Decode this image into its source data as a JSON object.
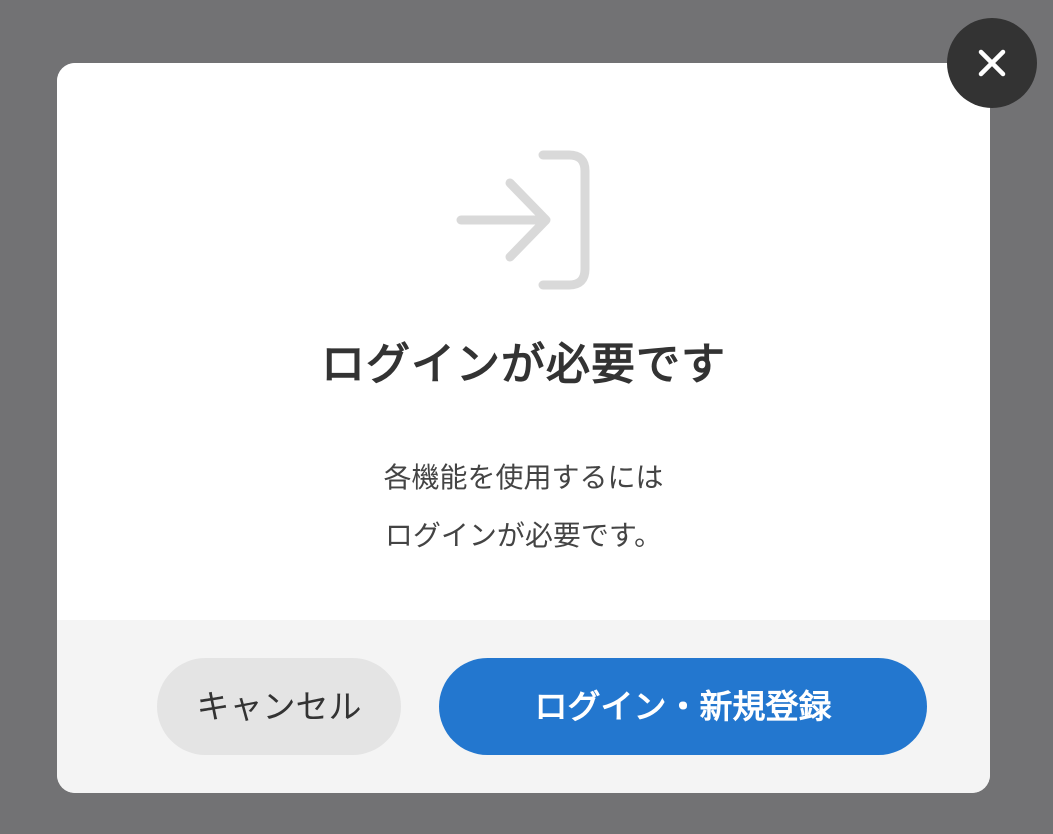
{
  "modal": {
    "title": "ログインが必要です",
    "message_lines": [
      "各機能を使用するには",
      "ログインが必要です。"
    ],
    "cancel_label": "キャンセル",
    "login_label": "ログイン・新規登録"
  },
  "icons": {
    "login": "login-arrow-icon",
    "close": "close-icon"
  },
  "colors": {
    "overlay": "#727274",
    "primary": "#2377cf",
    "cancel_bg": "#e4e4e4",
    "footer_bg": "#f4f4f4",
    "close_bg": "#333333",
    "icon": "#d9d9d9",
    "title": "#333333"
  }
}
